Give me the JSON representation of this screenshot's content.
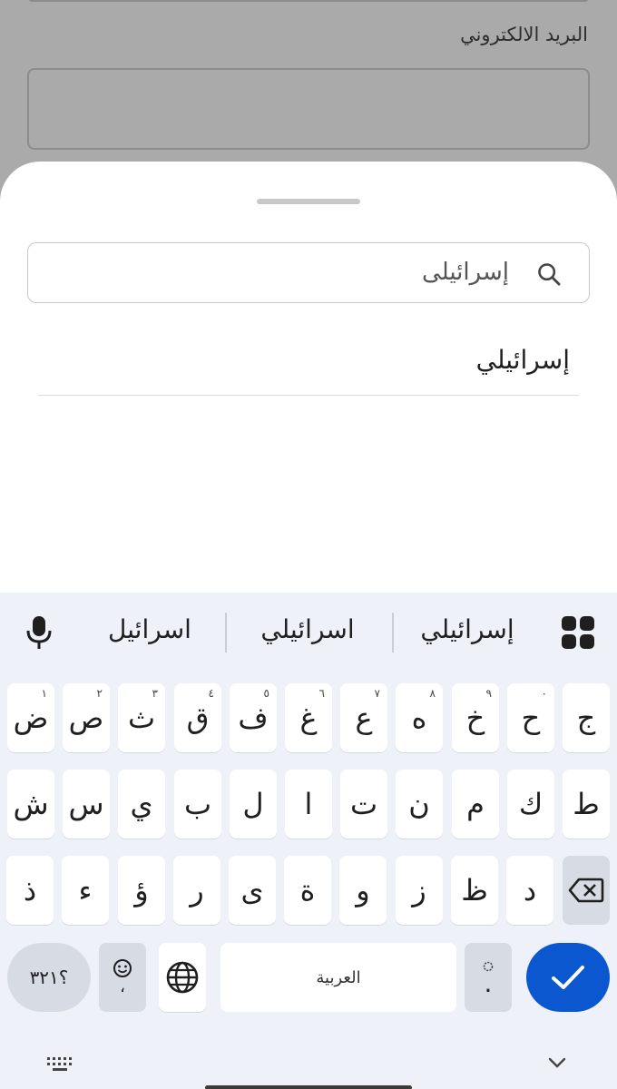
{
  "background": {
    "email_label": "البريد الالكتروني"
  },
  "sheet": {
    "search_value": "إسرائيلى",
    "result": "إسرائيلي"
  },
  "keyboard": {
    "suggestions": [
      "إسرائيلي",
      "اسرائيلي",
      "اسرائيل"
    ],
    "row1": [
      {
        "ch": "ج",
        "hint": ""
      },
      {
        "ch": "ح",
        "hint": "٠"
      },
      {
        "ch": "خ",
        "hint": "٩"
      },
      {
        "ch": "ه",
        "hint": "٨"
      },
      {
        "ch": "ع",
        "hint": "٧"
      },
      {
        "ch": "غ",
        "hint": "٦"
      },
      {
        "ch": "ف",
        "hint": "٥"
      },
      {
        "ch": "ق",
        "hint": "٤"
      },
      {
        "ch": "ث",
        "hint": "٣"
      },
      {
        "ch": "ص",
        "hint": "٢"
      },
      {
        "ch": "ض",
        "hint": "١"
      }
    ],
    "row2": [
      "ط",
      "ك",
      "م",
      "ن",
      "ت",
      "ا",
      "ل",
      "ب",
      "ي",
      "س",
      "ش"
    ],
    "row3": [
      "د",
      "ظ",
      "ز",
      "و",
      "ة",
      "ى",
      "ر",
      "ؤ",
      "ء",
      "ذ"
    ],
    "symbols_label": "؟٣٢١",
    "comma_label": "،",
    "space_label": "العربية",
    "period_label": ".",
    "accent": "#0b57d0"
  }
}
